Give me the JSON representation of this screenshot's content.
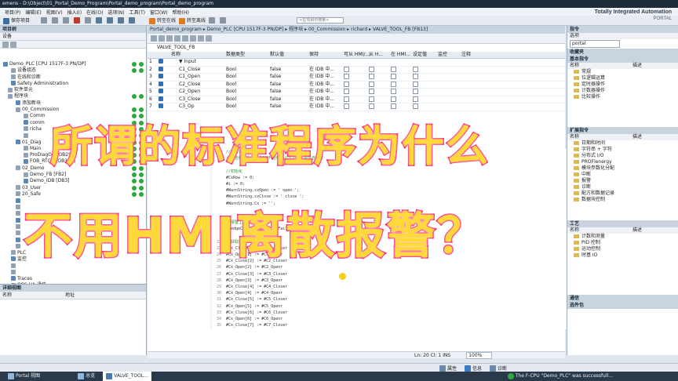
{
  "window": {
    "title": "emens - D:\\Object\\01_Portal_Demo_Program\\Portal_demo_program\\Portal_demo_program"
  },
  "menu": [
    "项目(P)",
    "编辑(E)",
    "视图(V)",
    "插入(I)",
    "在线(O)",
    "选项(N)",
    "工具(T)",
    "窗口(W)",
    "帮助(H)"
  ],
  "toolbar": {
    "save_project": "保存项目",
    "go_online": "转至在线",
    "go_offline": "转至离线",
    "search_placeholder": "<在项目中搜索>"
  },
  "brand": {
    "line1": "Totally Integrated Automation",
    "line2": "PORTAL"
  },
  "left_panel": {
    "title": "项目树",
    "subtitle": "设备",
    "tree": [
      {
        "label": "Demo_PLC [CPU 1517F-3 PN/DP]",
        "indent": 4,
        "status": true
      },
      {
        "label": "设备组态",
        "indent": 14,
        "status": true
      },
      {
        "label": "在线和诊断",
        "indent": 14,
        "status": false
      },
      {
        "label": "Safety Administration",
        "indent": 14,
        "status": false
      },
      {
        "label": "软件单元",
        "indent": 10,
        "status": false
      },
      {
        "label": "程序块",
        "indent": 10,
        "status": true
      },
      {
        "label": "添加新块",
        "indent": 20,
        "status": false
      },
      {
        "label": "00_Commission",
        "indent": 20,
        "status": true
      },
      {
        "label": "Comm",
        "indent": 30,
        "status": true
      },
      {
        "label": "comm",
        "indent": 30,
        "status": true
      },
      {
        "label": "richa",
        "indent": 30,
        "status": true
      },
      {
        "label": "",
        "indent": 30,
        "status": true
      },
      {
        "label": "01_Diag",
        "indent": 20,
        "status": true
      },
      {
        "label": "Main",
        "indent": 30,
        "status": true
      },
      {
        "label": "ProDiagOB [OB250]",
        "indent": 30,
        "status": true
      },
      {
        "label": "FOB_RTG1 [OB123]",
        "indent": 30,
        "status": true
      },
      {
        "label": "02_Demo",
        "indent": 20,
        "status": true
      },
      {
        "label": "Demo_FB [FB2]",
        "indent": 30,
        "status": true
      },
      {
        "label": "Demo_IDB [DB3]",
        "indent": 30,
        "status": true
      },
      {
        "label": "03_User",
        "indent": 20,
        "status": true
      },
      {
        "label": "20_Safe",
        "indent": 20,
        "status": true
      },
      {
        "label": "",
        "indent": 20,
        "status": false
      },
      {
        "label": "",
        "indent": 20,
        "status": false
      },
      {
        "label": "",
        "indent": 20,
        "status": false
      },
      {
        "label": "",
        "indent": 20,
        "status": false
      },
      {
        "label": "",
        "indent": 20,
        "status": false
      },
      {
        "label": "",
        "indent": 20,
        "status": false
      },
      {
        "label": "",
        "indent": 20,
        "status": false
      },
      {
        "label": "",
        "indent": 20,
        "status": false
      },
      {
        "label": "PLC",
        "indent": 14,
        "status": false
      },
      {
        "label": "监控",
        "indent": 14,
        "status": false
      },
      {
        "label": "",
        "indent": 14,
        "status": false
      },
      {
        "label": "",
        "indent": 14,
        "status": false
      },
      {
        "label": "Traces",
        "indent": 14,
        "status": false
      },
      {
        "label": "OPC UA 通信",
        "indent": 14,
        "status": false
      },
      {
        "label": "设备代理数据",
        "indent": 14,
        "status": false
      }
    ],
    "detail": {
      "title": "详细视图",
      "col_name": "名称",
      "col_address": "地址"
    }
  },
  "editor": {
    "breadcrumb": "Portal_demo_program ▸ Demo_PLC [CPU 1517F-3 PN/DP] ▸ 程序块 ▸ 00_Commission ▸ richard ▸ VALVE_TOOL_FB [FB13]",
    "block_name": "VALVE_TOOL_FB",
    "columns": [
      "名称",
      "数据类型",
      "默认值",
      "保持",
      "可从 HMI/...",
      "从 H...",
      "在 HMI...",
      "设定值",
      "监控",
      "注释"
    ],
    "rows": [
      {
        "num": "1",
        "name": "▼ Input",
        "type": "",
        "default": "",
        "retain": ""
      },
      {
        "num": "2",
        "name": "C1_Close",
        "type": "Bool",
        "default": "false",
        "retain": "在 IDB 中..."
      },
      {
        "num": "3",
        "name": "C1_Open",
        "type": "Bool",
        "default": "false",
        "retain": "在 IDB 中..."
      },
      {
        "num": "4",
        "name": "C2_Close",
        "type": "Bool",
        "default": "false",
        "retain": "在 IDB 中..."
      },
      {
        "num": "5",
        "name": "C2_Open",
        "type": "Bool",
        "default": "false",
        "retain": "在 IDB 中..."
      },
      {
        "num": "6",
        "name": "C3_Close",
        "type": "Bool",
        "default": "false",
        "retain": "在 IDB 中..."
      },
      {
        "num": "7",
        "name": "C3_Op",
        "type": "Bool",
        "default": "false",
        "retain": "在 IDB 中..."
      }
    ],
    "code": [
      {
        "n": "",
        "t": "//警告在HMI上显示·",
        "c": true
      },
      {
        "n": "",
        "t": "//警告触发后，连续2次开合时间小于比较值警告自复位·",
        "c": true
      },
      {
        "n": "",
        "t": "",
        "c": false
      },
      {
        "n": "",
        "t": "//初始化",
        "c": true
      },
      {
        "n": "",
        "t": "#CxRow := 0;",
        "c": false
      },
      {
        "n": "",
        "t": "#i := 0;",
        "c": false
      },
      {
        "n": "",
        "t": "#WarnString.cxOpen := ' open  ';",
        "c": false
      },
      {
        "n": "",
        "t": "#WarnString.cxClose := ' close ';",
        "c": false
      },
      {
        "n": "",
        "t": "#WarnString.Cx := '';",
        "c": false
      },
      {
        "n": "",
        "t": "",
        "c": false
      },
      {
        "n": "",
        "t": "",
        "c": false
      },
      {
        "n": "",
        "t": "//报警上升沿",
        "c": true
      },
      {
        "n": "",
        "t": "#RedgeCxFail(CLK:=#xCxFail);",
        "c": false
      },
      {
        "n": "",
        "t": "",
        "c": false
      },
      {
        "n": "22",
        "t": "//获取数据",
        "c": true
      },
      {
        "n": "23",
        "t": "#Cx_Close[1] := #C1_Closer",
        "c": false
      },
      {
        "n": "24",
        "t": "#Cx_Open[1] := #C1_Openr",
        "c": false
      },
      {
        "n": "25",
        "t": "#Cx_Close[2] := #C2_Closer",
        "c": false
      },
      {
        "n": "26",
        "t": "#Cx_Open[2] := #C2_Openr",
        "c": false
      },
      {
        "n": "27",
        "t": "#Cx_Close[3] := #C3_Closer",
        "c": false
      },
      {
        "n": "28",
        "t": "#Cx_Open[3] := #C3_Openr",
        "c": false
      },
      {
        "n": "29",
        "t": "#Cx_Close[4] := #C4_Closer",
        "c": false
      },
      {
        "n": "30",
        "t": "#Cx_Open[4] := #C4_Openr",
        "c": false
      },
      {
        "n": "31",
        "t": "#Cx_Close[5] := #C5_Closer",
        "c": false
      },
      {
        "n": "32",
        "t": "#Cx_Open[5] := #C5_Openr",
        "c": false
      },
      {
        "n": "33",
        "t": "#Cx_Close[6] := #C6_Closer",
        "c": false
      },
      {
        "n": "34",
        "t": "#Cx_Open[6] := #C6_Openr",
        "c": false
      },
      {
        "n": "35",
        "t": "#Cx_Close[7] := #C7_Closer",
        "c": false
      }
    ],
    "status": {
      "position": "Ln: 20   Cl: 1   INS",
      "zoom": "100%"
    }
  },
  "right_panel": {
    "title": "指令",
    "options": "选项",
    "options_value": "portal",
    "favorites": "收藏夹",
    "basic": "基本指令",
    "col_name": "名称",
    "col_desc": "描述",
    "basic_items": [
      "常规",
      "位逻辑运算",
      "定时器操作",
      "计数器操作",
      "比较操作"
    ],
    "extended": "扩展指令",
    "extended_items": [
      "日期和时间",
      "字符串 + 字符",
      "分布式 I/O",
      "PROFIenergy",
      "模块参数化分配",
      "中断",
      "报警",
      "诊断",
      "配方和数据记录",
      "数据块控制"
    ],
    "tech": "工艺",
    "tech_items": [
      "计数和测量",
      "PID 控制",
      "运动控制",
      "时基 IO"
    ],
    "comm": "通信",
    "optional": "选件包"
  },
  "info_bar": {
    "properties": "属性",
    "info": "信息",
    "diagnostics": "诊断"
  },
  "taskbar": {
    "portal": "Portal 视图",
    "overview": "总览",
    "active_tab": "VALVE_TOOL...",
    "message": "The F-CPU \"Demo_PLC\" was successfull..."
  },
  "overlay": {
    "line1": "所谓的标准程序为什么",
    "line2": "不用HMI离散报警？"
  }
}
